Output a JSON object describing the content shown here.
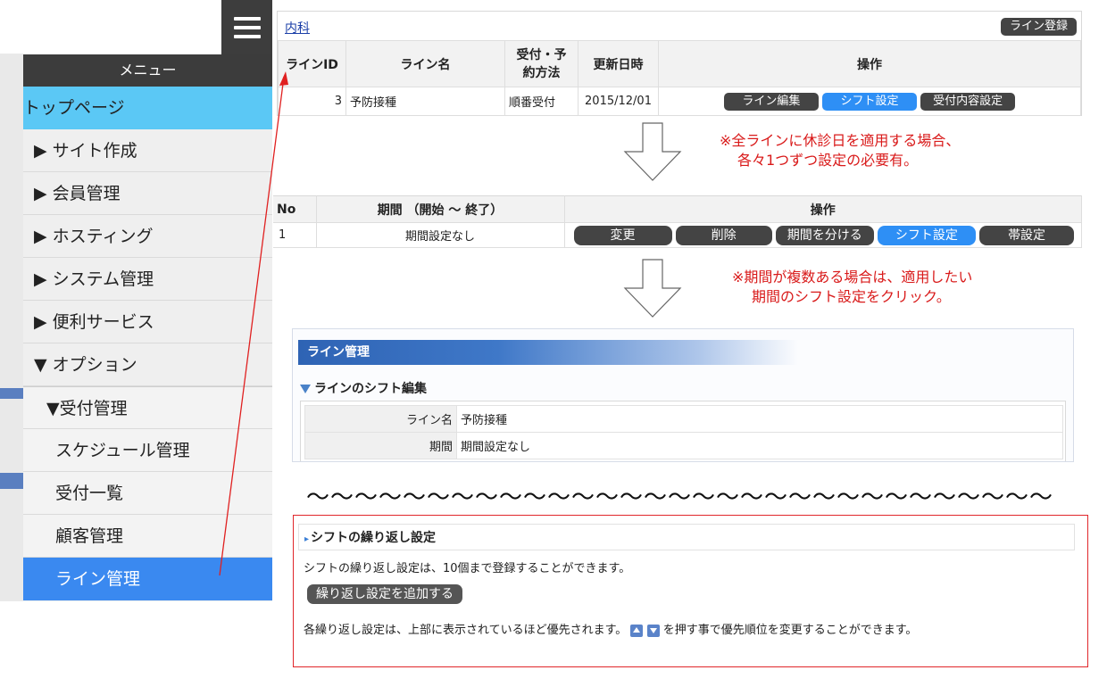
{
  "menu": {
    "header": "メニュー",
    "top_page": "トップページ",
    "items": [
      "▶ サイト作成",
      "▶ 会員管理",
      "▶ ホスティング",
      "▶ システム管理",
      "▶ 便利サービス",
      "▼ オプション"
    ],
    "sub_head": "▼受付管理",
    "sub_items": [
      "スケジュール管理",
      "受付一覧",
      "顧客管理"
    ],
    "active": "ライン管理"
  },
  "line_list": {
    "dept_link": "内科",
    "register_button": "ライン登録",
    "headers": [
      "ラインID",
      "ライン名",
      "受付・予約方法",
      "更新日時",
      "操作"
    ],
    "row": {
      "id": "3",
      "name": "予防接種",
      "method": "順番受付",
      "updated": "2015/12/01"
    },
    "actions": [
      "ライン編集",
      "シフト設定",
      "受付内容設定"
    ]
  },
  "note1": [
    "※全ラインに休診日を適用する場合、",
    "各々1つずつ設定の必要有。"
  ],
  "period_list": {
    "headers": [
      "No",
      "期間 （開始 〜 終了）",
      "操作"
    ],
    "row": {
      "no": "1",
      "period": "期間設定なし"
    },
    "actions": [
      "変更",
      "削除",
      "期間を分ける",
      "シフト設定",
      "帯設定"
    ]
  },
  "note2": [
    "※期間が複数ある場合は、適用したい",
    "期間のシフト設定をクリック。"
  ],
  "line_manage": {
    "title": "ライン管理",
    "subtitle": "ラインのシフト編集",
    "rows": [
      {
        "key": "ライン名",
        "value": "予防接種"
      },
      {
        "key": "期間",
        "value": "期間設定なし"
      }
    ]
  },
  "wave": "〜〜〜〜〜〜〜〜〜〜〜〜〜〜〜〜〜〜〜〜〜〜〜〜〜〜〜〜〜〜〜",
  "repeat": {
    "title": "シフトの繰り返し設定",
    "desc": "シフトの繰り返し設定は、10個まで登録することができます。",
    "add_button": "繰り返し設定を追加する",
    "priority_before": "各繰り返し設定は、上部に表示されているほど優先されます。",
    "priority_after": "を押す事で優先順位を変更することができます。"
  },
  "colors": {
    "accent_blue": "#2e8ff5",
    "menu_cyan": "#5bc8f5",
    "note_red": "#d91a1a"
  }
}
